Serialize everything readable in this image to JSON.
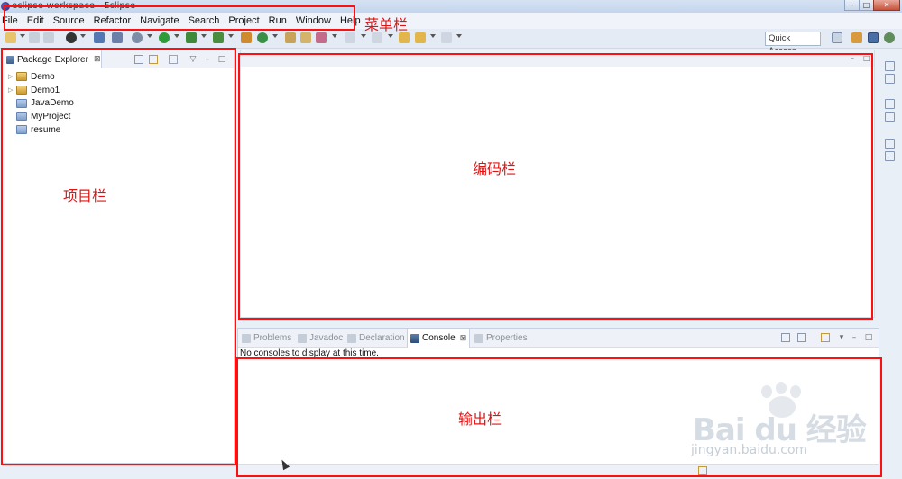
{
  "window": {
    "title": "eclipse-workspace - Eclipse",
    "min_label": "–",
    "max_label": "□",
    "close_label": "✕"
  },
  "menu": {
    "items": [
      "File",
      "Edit",
      "Source",
      "Refactor",
      "Navigate",
      "Search",
      "Project",
      "Run",
      "Window",
      "Help"
    ]
  },
  "toolbar": {
    "quick_access": "Quick Access"
  },
  "explorer": {
    "tab_label": "Package Explorer",
    "close_glyph": "⊠",
    "projects": [
      {
        "name": "Demo",
        "expandable": true,
        "kind": "java"
      },
      {
        "name": "Demo1",
        "expandable": true,
        "kind": "java"
      },
      {
        "name": "JavaDemo",
        "expandable": false,
        "kind": "plain"
      },
      {
        "name": "MyProject",
        "expandable": false,
        "kind": "plain"
      },
      {
        "name": "resume",
        "expandable": false,
        "kind": "plain"
      }
    ]
  },
  "console": {
    "tabs": [
      {
        "label": "Problems",
        "active": false
      },
      {
        "label": "Javadoc",
        "active": false
      },
      {
        "label": "Declaration",
        "active": false
      },
      {
        "label": "Console",
        "active": true
      },
      {
        "label": "Properties",
        "active": false
      }
    ],
    "message": "No consoles to display at this time."
  },
  "annotations": {
    "menu_label": "菜单栏",
    "project_label": "项目栏",
    "editor_label": "编码栏",
    "output_label": "输出栏",
    "color": "#ff1010"
  },
  "watermark": {
    "brand": "Bai du 经验",
    "url": "jingyan.baidu.com"
  }
}
